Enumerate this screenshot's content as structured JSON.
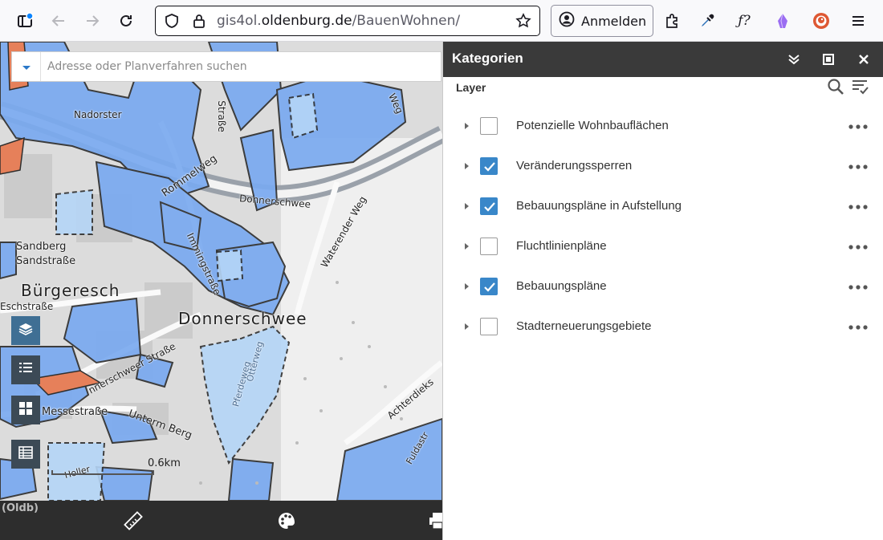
{
  "browser": {
    "url_prefix": "gis4ol.",
    "url_domain": "oldenburg.de",
    "url_path": "/BauenWohnen/",
    "login_label": "Anmelden"
  },
  "map": {
    "search_placeholder": "Adresse oder Planverfahren suchen",
    "scale_label": "0.6km",
    "bottom_title": "(Oldb)",
    "labels": {
      "buergeresch": "Bürgeresch",
      "donnerschwee": "Donnerschwee",
      "sandberg": "Sandberg",
      "sandstrasse": "Sandstraße",
      "eschstrasse": "Eschstraße",
      "messestrasse": "Messestraße",
      "unterm_berg": "Unterm Berg",
      "nadorster": "Nadorster",
      "strasse": "Straße",
      "rommelweg": "Rommelweg",
      "donnerschwee_road": "Donnerschwee",
      "waterender_weg": "Waterender Weg",
      "weg": "Weg",
      "donnerschweer_strasse": "nnerschweer Straße",
      "immingstrasse": "Immingstraße",
      "otterweg": "Otterweg",
      "pferdeweg": "Pferdeweg",
      "achterdieksweg": "Achterdieks",
      "fuldastrasse": "Fuldastr",
      "holler": "Holler"
    }
  },
  "panel": {
    "title": "Kategorien",
    "section_label": "Layer",
    "layers": [
      {
        "name": "Potenzielle Wohnbauflächen",
        "checked": false
      },
      {
        "name": "Veränderungssperren",
        "checked": true
      },
      {
        "name": "Bebauungspläne in Aufstellung",
        "checked": true
      },
      {
        "name": "Fluchtlinienpläne",
        "checked": false
      },
      {
        "name": "Bebauungspläne",
        "checked": true
      },
      {
        "name": "Stadterneuerungsgebiete",
        "checked": false
      }
    ]
  },
  "colors": {
    "plan_blue": "#7aaaf0",
    "plan_light_blue": "#b5d6f7",
    "highlight_orange": "#e6805a",
    "checkbox_blue": "#3987c9",
    "panel_header": "#3a3a3a"
  },
  "icons": {
    "browser": [
      "sidebar-icon",
      "back-arrow-icon",
      "forward-arrow-icon",
      "reload-icon",
      "shield-icon",
      "lock-icon",
      "star-icon",
      "account-icon",
      "extensions-icon",
      "eyedropper-icon",
      "formula-icon",
      "purple-extension-icon",
      "duckduckgo-icon",
      "menu-icon"
    ],
    "map": [
      "layers-icon",
      "list-icon",
      "grid-icon",
      "table-icon",
      "ruler-icon",
      "palette-icon",
      "print-icon"
    ],
    "panel": [
      "collapse-icon",
      "maximize-icon",
      "close-icon",
      "search-icon",
      "filter-icon",
      "caret-icon",
      "more-icon"
    ]
  }
}
